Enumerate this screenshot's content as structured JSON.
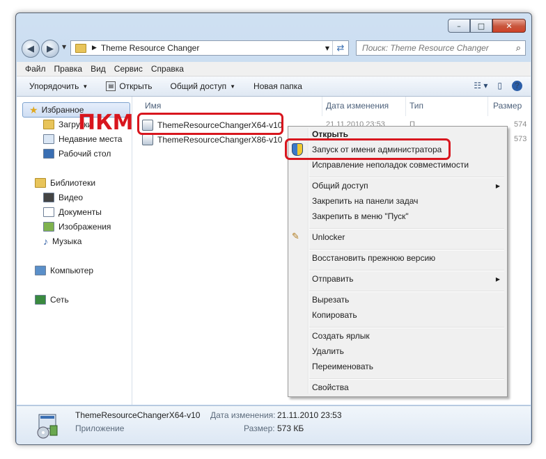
{
  "window": {
    "address_path": "Theme Resource Changer",
    "search_placeholder": "Поиск: Theme Resource Changer"
  },
  "menubar": [
    "Файл",
    "Правка",
    "Вид",
    "Сервис",
    "Справка"
  ],
  "toolbar": {
    "organize": "Упорядочить",
    "open": "Открыть",
    "share": "Общий доступ",
    "new_folder": "Новая папка"
  },
  "nav": {
    "favorites": "Избранное",
    "downloads": "Загрузки",
    "recent": "Недавние места",
    "desktop": "Рабочий стол",
    "libraries": "Библиотеки",
    "video": "Видео",
    "documents": "Документы",
    "images": "Изображения",
    "music": "Музыка",
    "computer": "Компьютер",
    "network": "Сеть"
  },
  "columns": {
    "name": "Имя",
    "date": "Дата изменения",
    "type": "Тип",
    "size": "Размер"
  },
  "files": [
    {
      "name": "ThemeResourceChangerX64-v10",
      "date": "21.11.2010 23:53",
      "type": "П",
      "size": "574"
    },
    {
      "name": "ThemeResourceChangerX86-v10",
      "date": "",
      "type": "",
      "size": "573"
    }
  ],
  "annotation": "ПКМ",
  "context_menu": {
    "open": "Открыть",
    "run_as_admin": "Запуск от имени администратора",
    "troubleshoot": "Исправление неполадок совместимости",
    "share": "Общий доступ",
    "pin_taskbar": "Закрепить на панели задач",
    "pin_start": "Закрепить в меню \"Пуск\"",
    "unlocker": "Unlocker",
    "restore": "Восстановить прежнюю версию",
    "send_to": "Отправить",
    "cut": "Вырезать",
    "copy": "Копировать",
    "create_shortcut": "Создать ярлык",
    "delete": "Удалить",
    "rename": "Переименовать",
    "properties": "Свойства"
  },
  "details": {
    "name": "ThemeResourceChangerX64-v10",
    "kind": "Приложение",
    "date_label": "Дата изменения:",
    "date_value": "21.11.2010 23:53",
    "size_label": "Размер:",
    "size_value": "573 КБ"
  }
}
